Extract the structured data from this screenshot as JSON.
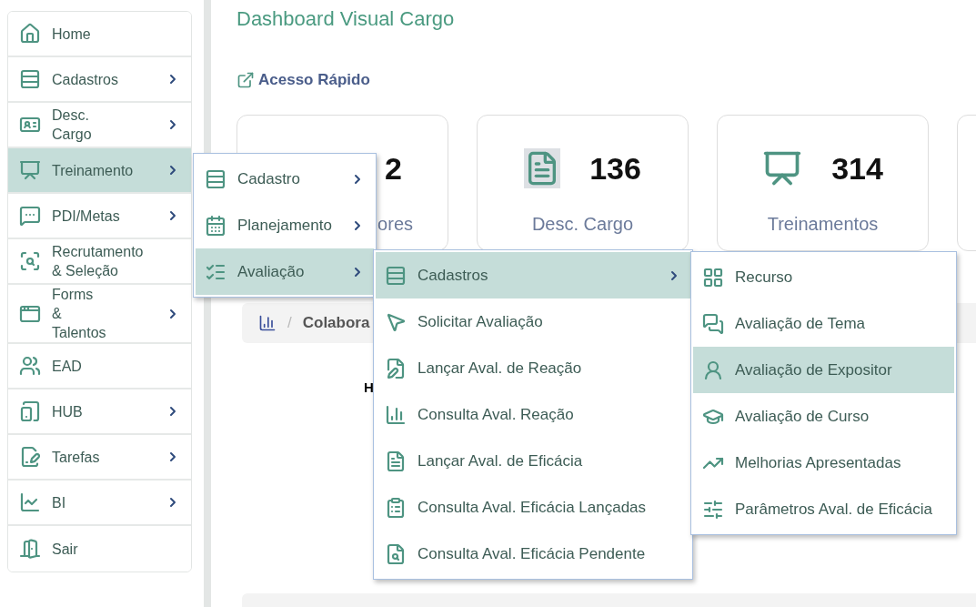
{
  "sidebar": {
    "items": [
      {
        "label": "Home",
        "has_submenu": false,
        "selected": false
      },
      {
        "label": "Cadastros",
        "has_submenu": true,
        "selected": false
      },
      {
        "label": "Desc. Cargo",
        "has_submenu": true,
        "selected": false
      },
      {
        "label": "Treinamento",
        "has_submenu": true,
        "selected": true
      },
      {
        "label": "PDI/Metas",
        "has_submenu": true,
        "selected": false
      },
      {
        "label": "Recrutamento & Seleção",
        "has_submenu": false,
        "selected": false
      },
      {
        "label": "Forms & Talentos",
        "has_submenu": true,
        "selected": false
      },
      {
        "label": "EAD",
        "has_submenu": false,
        "selected": false
      },
      {
        "label": "HUB",
        "has_submenu": true,
        "selected": false
      },
      {
        "label": "Tarefas",
        "has_submenu": true,
        "selected": false
      },
      {
        "label": "BI",
        "has_submenu": true,
        "selected": false
      },
      {
        "label": "Sair",
        "has_submenu": false,
        "selected": false
      }
    ]
  },
  "main": {
    "title": "Dashboard Visual Cargo",
    "quick_access": "Acesso Rápido",
    "cards": [
      {
        "value": "2",
        "label": "ores"
      },
      {
        "value": "136",
        "label": "Desc. Cargo"
      },
      {
        "value": "314",
        "label": "Treinamentos"
      }
    ],
    "breadcrumb": {
      "separator": "/",
      "label": "Colabora"
    },
    "fragment": "H"
  },
  "menus": [
    {
      "items": [
        {
          "label": "Cadastro",
          "has_submenu": true,
          "selected": false
        },
        {
          "label": "Planejamento",
          "has_submenu": true,
          "selected": false
        },
        {
          "label": "Avaliação",
          "has_submenu": true,
          "selected": true
        }
      ]
    },
    {
      "items": [
        {
          "label": "Cadastros",
          "has_submenu": true,
          "selected": true
        },
        {
          "label": "Solicitar Avaliação",
          "has_submenu": false,
          "selected": false
        },
        {
          "label": "Lançar Aval. de Reação",
          "has_submenu": false,
          "selected": false
        },
        {
          "label": "Consulta Aval. Reação",
          "has_submenu": false,
          "selected": false
        },
        {
          "label": "Lançar Aval. de Eficácia",
          "has_submenu": false,
          "selected": false
        },
        {
          "label": "Consulta Aval. Eficácia Lançadas",
          "has_submenu": false,
          "selected": false
        },
        {
          "label": "Consulta Aval. Eficácia Pendente",
          "has_submenu": false,
          "selected": false
        }
      ]
    },
    {
      "items": [
        {
          "label": "Recurso",
          "has_submenu": false,
          "selected": false
        },
        {
          "label": "Avaliação de Tema",
          "has_submenu": false,
          "selected": false
        },
        {
          "label": "Avaliação de Expositor",
          "has_submenu": false,
          "selected": true
        },
        {
          "label": "Avaliação de Curso",
          "has_submenu": false,
          "selected": false
        },
        {
          "label": "Melhorias Apresentadas",
          "has_submenu": false,
          "selected": false
        },
        {
          "label": "Parâmetros Aval. de Eficácia",
          "has_submenu": false,
          "selected": false
        }
      ]
    }
  ]
}
